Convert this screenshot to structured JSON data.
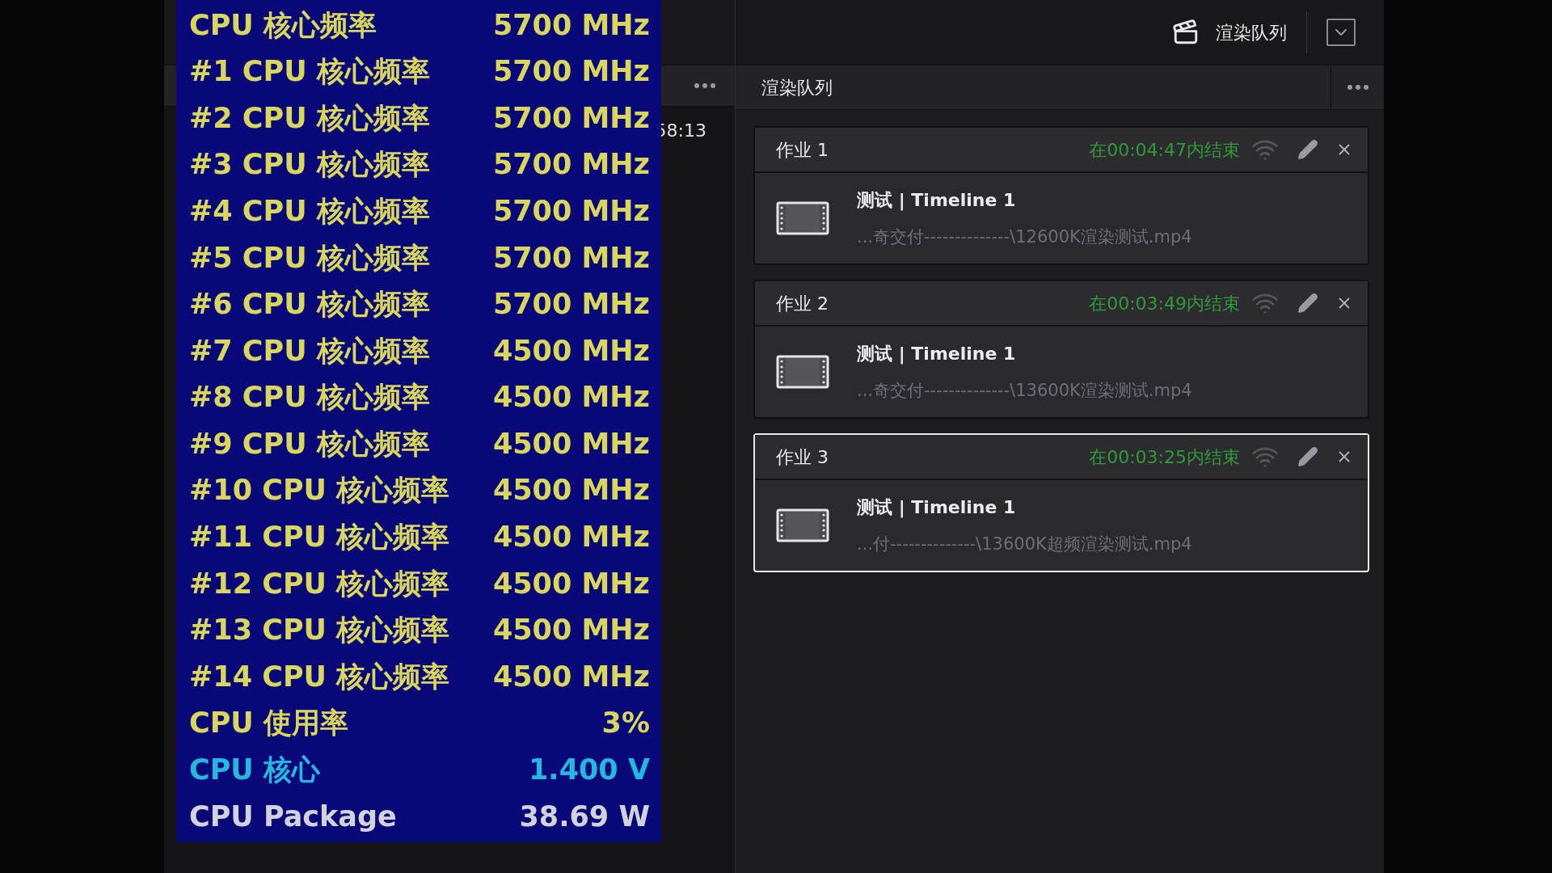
{
  "osd": {
    "rows": [
      {
        "label": "CPU 核心频率",
        "value": "5700 MHz",
        "color": "#d8d65c"
      },
      {
        "label": "#1 CPU 核心频率",
        "value": "5700 MHz",
        "color": "#d8d65c"
      },
      {
        "label": "#2 CPU 核心频率",
        "value": "5700 MHz",
        "color": "#d8d65c"
      },
      {
        "label": "#3 CPU 核心频率",
        "value": "5700 MHz",
        "color": "#d8d65c"
      },
      {
        "label": "#4 CPU 核心频率",
        "value": "5700 MHz",
        "color": "#d8d65c"
      },
      {
        "label": "#5 CPU 核心频率",
        "value": "5700 MHz",
        "color": "#d8d65c"
      },
      {
        "label": "#6 CPU 核心频率",
        "value": "5700 MHz",
        "color": "#d8d65c"
      },
      {
        "label": "#7 CPU 核心频率",
        "value": "4500 MHz",
        "color": "#d8d65c"
      },
      {
        "label": "#8 CPU 核心频率",
        "value": "4500 MHz",
        "color": "#d8d65c"
      },
      {
        "label": "#9 CPU 核心频率",
        "value": "4500 MHz",
        "color": "#d8d65c"
      },
      {
        "label": "#10 CPU 核心频率",
        "value": "4500 MHz",
        "color": "#d8d65c"
      },
      {
        "label": "#11 CPU 核心频率",
        "value": "4500 MHz",
        "color": "#d8d65c"
      },
      {
        "label": "#12 CPU 核心频率",
        "value": "4500 MHz",
        "color": "#d8d65c"
      },
      {
        "label": "#13 CPU 核心频率",
        "value": "4500 MHz",
        "color": "#d8d65c"
      },
      {
        "label": "#14 CPU 核心频率",
        "value": "4500 MHz",
        "color": "#d8d65c"
      },
      {
        "label": "CPU 使用率",
        "value": "3%",
        "color": "#d8d65c"
      },
      {
        "label": "CPU 核心",
        "value": "1.400 V",
        "color": "#24b8e0"
      },
      {
        "label": "CPU Package",
        "value": "38.69 W",
        "color": "#d2d2da"
      }
    ]
  },
  "viewer": {
    "duration_tail": "58:13"
  },
  "header": {
    "title": "渲染队列"
  },
  "render_queue": {
    "title": "渲染队列",
    "jobs": [
      {
        "title": "作业 1",
        "eta": "在00:04:47内结束",
        "name": "测试 | Timeline 1",
        "path": "...奇交付--------------\\12600K渲染测试.mp4",
        "selected": false
      },
      {
        "title": "作业 2",
        "eta": "在00:03:49内结束",
        "name": "测试 | Timeline 1",
        "path": "...奇交付--------------\\13600K渲染测试.mp4",
        "selected": false
      },
      {
        "title": "作业 3",
        "eta": "在00:03:25内结束",
        "name": "测试 | Timeline 1",
        "path": "...付--------------\\13600K超频渲染测试.mp4",
        "selected": true
      }
    ]
  }
}
